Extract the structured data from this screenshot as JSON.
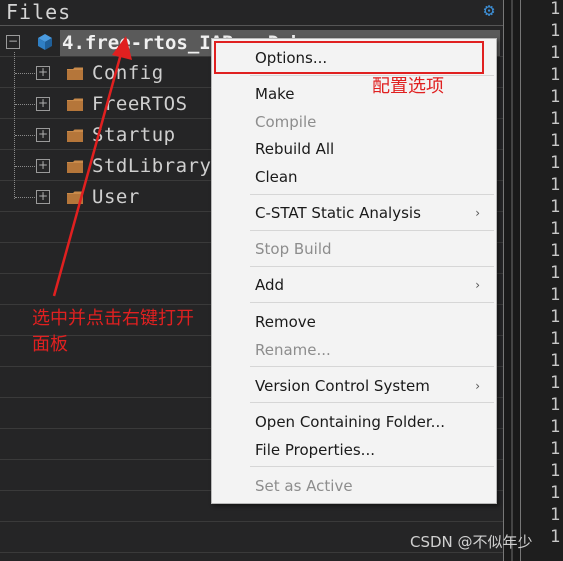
{
  "workspace": {
    "header": "Files",
    "project": {
      "name": "4.free-rtos_IAR - Debug"
    },
    "folders": [
      {
        "label": "Config"
      },
      {
        "label": "FreeRTOS"
      },
      {
        "label": "Startup"
      },
      {
        "label": "StdLibrary"
      },
      {
        "label": "User"
      }
    ],
    "toggle_symbol_collapse": "−",
    "toggle_symbol_expand": "+"
  },
  "editor": {
    "line_numbers": [
      "1",
      "1",
      "1",
      "1",
      "1",
      "1",
      "1",
      "1",
      "1",
      "1",
      "1",
      "1",
      "1",
      "1",
      "1",
      "1",
      "1",
      "1",
      "1",
      "1",
      "1",
      "1",
      "1",
      "1",
      "1"
    ]
  },
  "context_menu": {
    "items": [
      {
        "label": "Options...",
        "enabled": true
      },
      {
        "label": "Make",
        "enabled": true
      },
      {
        "label": "Compile",
        "enabled": false
      },
      {
        "label": "Rebuild All",
        "enabled": true
      },
      {
        "label": "Clean",
        "enabled": true
      },
      {
        "label": "C-STAT Static Analysis",
        "enabled": true,
        "submenu": true
      },
      {
        "label": "Stop Build",
        "enabled": false
      },
      {
        "label": "Add",
        "enabled": true,
        "submenu": true
      },
      {
        "label": "Remove",
        "enabled": true
      },
      {
        "label": "Rename...",
        "enabled": false
      },
      {
        "label": "Version Control System",
        "enabled": true,
        "submenu": true
      },
      {
        "label": "Open Containing Folder...",
        "enabled": true
      },
      {
        "label": "File Properties...",
        "enabled": true
      },
      {
        "label": "Set as Active",
        "enabled": false
      }
    ],
    "submenu_arrow": "›"
  },
  "annotations": {
    "options_note": "配置选项",
    "select_note": "选中并点击右键打开面板",
    "color": "#e02020"
  },
  "watermark": "CSDN @不似年少",
  "colors": {
    "selection": "#5a5a5a",
    "gear": "#3d8fd6",
    "cube": "#2f7fc4",
    "folder": "#c98a4a"
  }
}
